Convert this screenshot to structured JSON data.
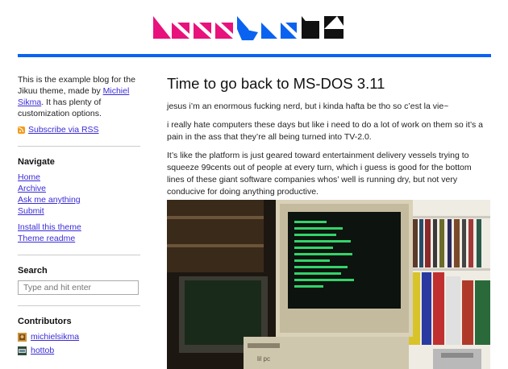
{
  "sidebar": {
    "intro_before": "This is the example blog for the Jikuu theme, made by ",
    "author_link": "Michiel Sikma",
    "intro_after": ". It has plenty of customization options.",
    "rss_label": "Subscribe via RSS",
    "navigate_title": "Navigate",
    "nav": [
      "Home",
      "Archive",
      "Ask me anything",
      "Submit"
    ],
    "theme_links": [
      "Install this theme",
      "Theme readme"
    ],
    "search_title": "Search",
    "search_placeholder": "Type and hit enter",
    "contributors_title": "Contributors",
    "contributors": [
      "michielsikma",
      "hottob"
    ]
  },
  "post": {
    "title": "Time to go back to MS-DOS 3.11",
    "paragraphs": [
      "jesus i’m an enormous fucking nerd, but i kinda hafta be tho so c’est la vie~",
      "i really hate computers these days but like i need to do a lot of work on them so it’s a pain in the ass that they’re all being turned into TV-2.0.",
      "It’s like the platform is just geared toward entertainment delivery vessels trying to squeeze 99cents out of people at every turn, which i guess is good for the bottom lines of these giant software companies whos’ well is running dry, but not very conducive for doing anything productive."
    ],
    "photo_label": "lil pc"
  },
  "colors": {
    "accent_blue": "#0a63f0",
    "logo_pink": "#e8127c",
    "logo_black": "#111111",
    "link": "#3a2bd6",
    "rss_orange": "#f29b1e"
  }
}
